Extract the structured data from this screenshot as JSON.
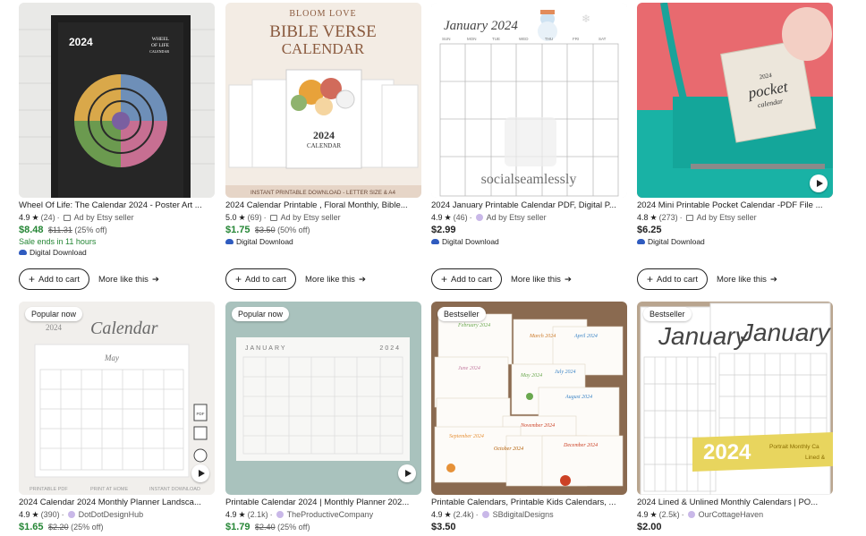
{
  "listings_row1": [
    {
      "title": "Wheel Of Life: The Calendar 2024 - Poster Art ...",
      "rating": "4.9",
      "reviews": "(24)",
      "shop": "Ad by Etsy seller",
      "price": "$8.48",
      "original_price": "$11.31",
      "discount": "(25% off)",
      "sale_note": "Sale ends in 11 hours",
      "download": "Digital Download",
      "thumb_text": [
        "2024",
        "WHEEL",
        "OF LIFE",
        "CALENDAR"
      ]
    },
    {
      "title": "2024 Calendar Printable , Floral Monthly, Bible...",
      "rating": "5.0",
      "reviews": "(69)",
      "shop": "Ad by Etsy seller",
      "price": "$1.75",
      "original_price": "$3.50",
      "discount": "(50% off)",
      "download": "Digital Download",
      "thumb_text": [
        "BLOOM LOVE",
        "BIBLE VERSE",
        "CALENDAR",
        "2024",
        "CALENDAR",
        "INSTANT PRINTABLE DOWNLOAD - LETTER SIZE & A4"
      ]
    },
    {
      "title": "2024 January Printable Calendar PDF, Digital P...",
      "rating": "4.9",
      "reviews": "(46)",
      "shop": "Ad by Etsy seller",
      "price": "$2.99",
      "download": "Digital Download",
      "thumb_text": [
        "January 2024",
        "socialseamlessly"
      ],
      "weekdays": [
        "SUN",
        "MON",
        "TUE",
        "WED",
        "THU",
        "FRI",
        "SAT"
      ]
    },
    {
      "title": "2024 Mini Printable Pocket Calendar -PDF File ...",
      "rating": "4.8",
      "reviews": "(273)",
      "shop": "Ad by Etsy seller",
      "price": "$6.25",
      "download": "Digital Download",
      "thumb_text": [
        "2024",
        "pocket",
        "calendar"
      ]
    }
  ],
  "listings_row2": [
    {
      "title": "2024 Calendar 2024 Monthly Planner Landsca...",
      "rating": "4.9",
      "reviews": "(390)",
      "shop": "DotDotDesignHub",
      "price": "$1.65",
      "original_price": "$2.20",
      "discount": "(25% off)",
      "badge": "Popular now",
      "thumb_text": [
        "2024",
        "Calendar",
        "May",
        "PRINTABLE PDF",
        "PRINT AT HOME",
        "INSTANT DOWNLOAD",
        "PDF"
      ]
    },
    {
      "title": "Printable Calendar 2024 | Monthly Planner 202...",
      "rating": "4.9",
      "reviews": "(2.1k)",
      "shop": "TheProductiveCompany",
      "price": "$1.79",
      "original_price": "$2.40",
      "discount": "(25% off)",
      "badge": "Popular now",
      "thumb_text": [
        "JANUARY",
        "2024"
      ]
    },
    {
      "title": "Printable Calendars, Printable Kids Calendars, ...",
      "rating": "4.9",
      "reviews": "(2.4k)",
      "shop": "SBdigitalDesigns",
      "price": "$3.50",
      "badge": "Bestseller",
      "thumb_text": [
        "February 2024",
        "April 2024",
        "March 2024",
        "July 2024",
        "June 2024",
        "May 2024",
        "August 2024",
        "November 2024",
        "September 2024",
        "October 2024",
        "December 2024"
      ]
    },
    {
      "title": "2024 Lined & Unlined Monthly Calendars | PO...",
      "rating": "4.9",
      "reviews": "(2.5k)",
      "shop": "OurCottageHaven",
      "price": "$2.00",
      "badge": "Bestseller",
      "thumb_text": [
        "January",
        "January",
        "2024",
        "Portrait Monthly Ca",
        "Lined &"
      ]
    }
  ],
  "buttons": {
    "add_to_cart": "Add to cart",
    "more_like_this": "More like this"
  },
  "colors": {
    "sale_green": "#258635",
    "text": "#222222",
    "muted": "#595959"
  },
  "icons": {
    "star": "★",
    "arrow": "➔",
    "plus": "+"
  }
}
